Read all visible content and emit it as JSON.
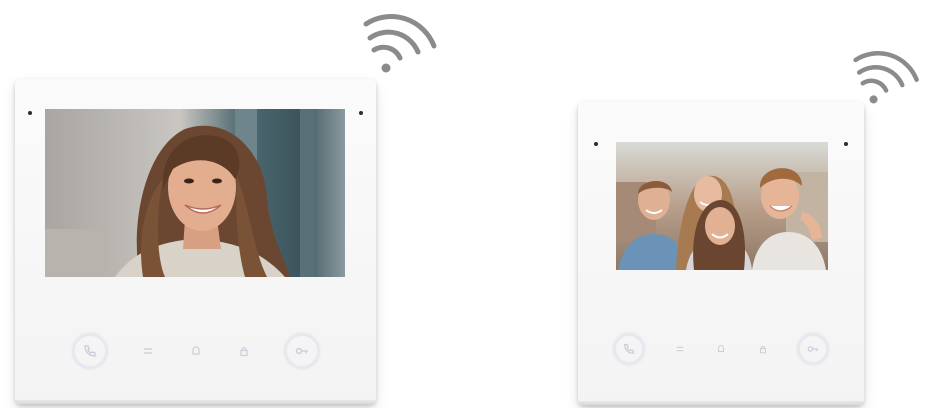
{
  "monitors": [
    {
      "brand": "",
      "screen_content": "woman-portrait",
      "buttons": [
        "talk-icon",
        "menu-icon",
        "bell-icon",
        "lock-icon",
        "key-icon"
      ]
    },
    {
      "brand": "",
      "screen_content": "group-selfie",
      "buttons": [
        "talk-icon",
        "menu-icon",
        "bell-icon",
        "lock-icon",
        "key-icon"
      ]
    }
  ],
  "colors": {
    "wifi": "#8b8b8b",
    "device_body": "#f6f6f6",
    "touch_icon": "#c9ceda"
  }
}
